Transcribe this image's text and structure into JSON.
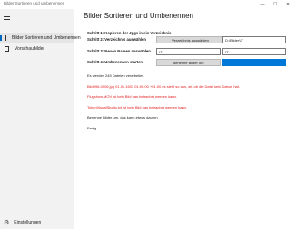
{
  "window": {
    "title": "Bilder Sortieren und umbenennen",
    "controls": {
      "minimize": "—",
      "maximize": "☐",
      "close": "✕"
    }
  },
  "sidebar": {
    "items": [
      {
        "label": "Bilder Sortieren und Umbenennen",
        "icon": "image-icon",
        "active": true
      },
      {
        "label": "Vorschaubilder",
        "icon": "document-icon",
        "active": false
      }
    ],
    "settings_label": "Einstellungen"
  },
  "page": {
    "title": "Bilder Sortieren und Umbenennen",
    "steps": {
      "step1": "Schritt 1: Kopieren der Jpgs in ein Verzeichnis",
      "step2": "Schritt 2: Verzeichnis auswählen",
      "step3": "Schritt 3: Neuen Namen auswählen",
      "step4": "Schritt 4: Umbenennen starten"
    },
    "select_folder_button": "Verzeichnis auswählen",
    "folder_path": "D:\\Bilder\\IT",
    "name_input_1": "IT",
    "name_input_2": "IT",
    "rename_button": "Benenne Bilder um",
    "progress_fraction": 1.0,
    "log": [
      {
        "text": "Es werden 245 Dateien verarbeitet.",
        "type": "normal"
      },
      {
        "text": "Bild996-0006.jpg 01.01.1601 01:00:00 +01:00 es sieht so aus, als ob die Datei kein Datum hat.",
        "type": "error"
      },
      {
        "text": "Flugshow.MOV ist kein Bild bas betrachet werden kann.",
        "type": "error"
      },
      {
        "text": "TokenVisualStudio.txt ist kein Bild bas betrachet werden kann.",
        "type": "error"
      },
      {
        "text": "Benenne Bilder um. das kann etwas dauern",
        "type": "normal"
      },
      {
        "text": "Fertig.",
        "type": "normal"
      }
    ]
  }
}
